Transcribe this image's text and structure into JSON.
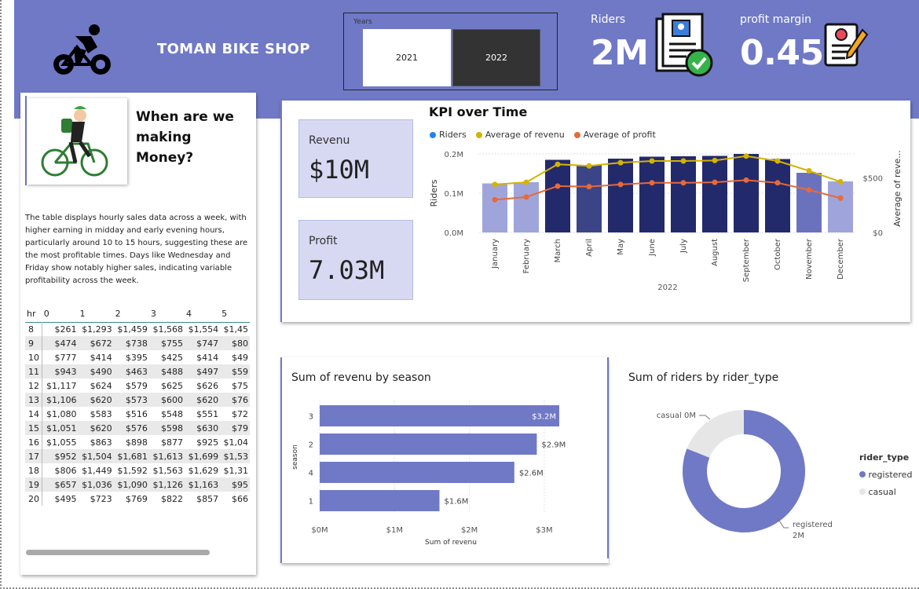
{
  "header": {
    "shop_title": "TOMAN BIKE SHOP",
    "slicer_label": "Years",
    "years": [
      "2021",
      "2022"
    ],
    "selected_year": "2022",
    "riders_label": "Riders",
    "riders_value": "2M",
    "profit_margin_label": "profit margin",
    "profit_margin_value": "0.45",
    "icons": [
      "bicycle-icon",
      "document-check-icon",
      "resume-pencil-icon"
    ]
  },
  "left_panel": {
    "question": "When are we making Money?",
    "description": "The table displays hourly sales data across a week, with higher earning in midday and early evening hours, particularly around 10 to 15 hours, suggesting these are the most profitable times. Days like Wednesday and Friday show notably higher sales, indicating variable profitability across the week.",
    "table": {
      "headers": [
        "hr",
        "0",
        "1",
        "2",
        "3",
        "4",
        "5"
      ],
      "rows": [
        [
          "8",
          "$261",
          "$1,293",
          "$1,459",
          "$1,568",
          "$1,554",
          "$1,45"
        ],
        [
          "9",
          "$474",
          "$672",
          "$738",
          "$755",
          "$747",
          "$80"
        ],
        [
          "10",
          "$777",
          "$414",
          "$395",
          "$425",
          "$414",
          "$49"
        ],
        [
          "11",
          "$943",
          "$490",
          "$463",
          "$488",
          "$497",
          "$59"
        ],
        [
          "12",
          "$1,117",
          "$624",
          "$579",
          "$625",
          "$626",
          "$75"
        ],
        [
          "13",
          "$1,106",
          "$620",
          "$573",
          "$600",
          "$620",
          "$76"
        ],
        [
          "14",
          "$1,080",
          "$583",
          "$516",
          "$548",
          "$551",
          "$72"
        ],
        [
          "15",
          "$1,051",
          "$620",
          "$576",
          "$598",
          "$630",
          "$79"
        ],
        [
          "16",
          "$1,055",
          "$863",
          "$898",
          "$877",
          "$925",
          "$1,04"
        ],
        [
          "17",
          "$952",
          "$1,504",
          "$1,681",
          "$1,613",
          "$1,699",
          "$1,53"
        ],
        [
          "18",
          "$806",
          "$1,449",
          "$1,592",
          "$1,563",
          "$1,629",
          "$1,31"
        ],
        [
          "19",
          "$657",
          "$1,036",
          "$1,090",
          "$1,126",
          "$1,163",
          "$95"
        ],
        [
          "20",
          "$495",
          "$723",
          "$769",
          "$822",
          "$857",
          "$66"
        ]
      ]
    }
  },
  "kpi_cards": {
    "revenue_label": "Revenu",
    "revenue_value": "$10M",
    "profit_label": "Profit",
    "profit_value": "7.03M"
  },
  "kpi_chart": {
    "title": "KPI over Time",
    "legend": [
      "Riders",
      "Average of revenu",
      "Average of profit"
    ],
    "colors": {
      "riders": "#1f86e8",
      "revenue": "#d4b300",
      "profit": "#e8693a",
      "bar_dark": "#222a6b",
      "bar_light": "#9fa5db"
    }
  },
  "season_chart": {
    "title": "Sum of revenu by season",
    "ylabel": "season",
    "xlabel": "Sum of revenu",
    "bar_color": "#7079c6"
  },
  "rider_type_chart": {
    "title": "Sum of riders by rider_type",
    "legend_title": "rider_type",
    "slice_labels": [
      "registered",
      "2M",
      "casual 0M"
    ],
    "colors": {
      "registered": "#7079c6",
      "casual": "#e6e6e6"
    }
  },
  "chart_data": [
    {
      "type": "bar",
      "title": "KPI over Time",
      "categories": [
        "January",
        "February",
        "March",
        "April",
        "May",
        "June",
        "July",
        "August",
        "September",
        "October",
        "November",
        "December"
      ],
      "xlabel": "2022",
      "ylabel": "Riders",
      "y2label": "Average of reve...",
      "ylim": [
        0,
        200000
      ],
      "y_ticks": [
        "0.0M",
        "0.1M",
        "0.2M"
      ],
      "y2_ticks": [
        "$0",
        "$500"
      ],
      "y2lim": [
        0,
        720
      ],
      "series": [
        {
          "name": "Riders",
          "type": "bar",
          "values": [
            125000,
            128000,
            185000,
            172000,
            188000,
            193000,
            194000,
            195000,
            200000,
            187000,
            152000,
            130000
          ]
        },
        {
          "name": "Average of revenu",
          "type": "line",
          "axis": "right",
          "values": [
            440,
            460,
            625,
            610,
            640,
            655,
            655,
            660,
            700,
            655,
            565,
            465
          ]
        },
        {
          "name": "Average of profit",
          "type": "line",
          "axis": "right",
          "values": [
            300,
            325,
            425,
            420,
            440,
            455,
            455,
            460,
            480,
            455,
            390,
            315
          ]
        }
      ]
    },
    {
      "type": "bar",
      "orientation": "horizontal",
      "title": "Sum of revenu by season",
      "categories": [
        "3",
        "2",
        "4",
        "1"
      ],
      "values": [
        3.2,
        2.9,
        2.6,
        1.6
      ],
      "value_labels": [
        "$3.2M",
        "$2.9M",
        "$2.6M",
        "$1.6M"
      ],
      "x_ticks": [
        "$0M",
        "$1M",
        "$2M",
        "$3M"
      ],
      "xlim": [
        0,
        3.2
      ],
      "xlabel": "Sum of revenu",
      "ylabel": "season"
    },
    {
      "type": "pie",
      "title": "Sum of riders by rider_type",
      "categories": [
        "registered",
        "casual"
      ],
      "values": [
        0.81,
        0.19
      ],
      "value_labels": [
        "2M",
        "0M"
      ]
    }
  ]
}
